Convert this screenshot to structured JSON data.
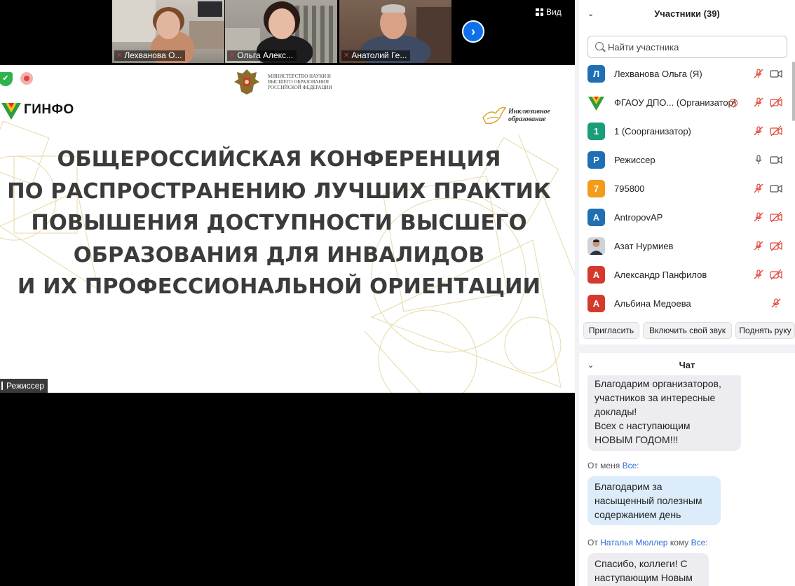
{
  "thumbnails": [
    {
      "name": "Лехванова О..."
    },
    {
      "name": "Ольга Алекс..."
    },
    {
      "name": "Анатолий Ге..."
    }
  ],
  "view_label": "Вид",
  "slide": {
    "ministry": "МИНИСТЕРСТВО НАУКИ И ВЫСШЕГО ОБРАЗОВАНИЯ РОССИЙСКОЙ ФЕДЕРАЦИИ",
    "ginfo": "ГИНФО",
    "inclusive": "Инклюзивное образование",
    "title_lines": [
      "ОБЩЕРОССИЙСКАЯ КОНФЕРЕНЦИЯ",
      "ПО РАСПРОСТРАНЕНИЮ ЛУЧШИХ ПРАКТИК",
      "ПОВЫШЕНИЯ ДОСТУПНОСТИ ВЫСШЕГО",
      "ОБРАЗОВАНИЯ ДЛЯ ИНВАЛИДОВ",
      "И ИХ ПРОФЕССИОНАЛЬНОЙ ОРИЕНТАЦИИ"
    ],
    "speaker_label": "Режиссер"
  },
  "participants": {
    "header": "Участники (39)",
    "search_placeholder": "Найти участника",
    "items": [
      {
        "initial": "Л",
        "name": "Лехванова Ольга (Я)",
        "color": "#1f6fb5"
      },
      {
        "initial": "",
        "name": "ФГАОУ ДПО... (Организатор)",
        "color": "#ffffff"
      },
      {
        "initial": "1",
        "name": "1 (Соорганизатор)",
        "color": "#1a9e7a"
      },
      {
        "initial": "Р",
        "name": "Режиссер",
        "color": "#1f6fb5"
      },
      {
        "initial": "7",
        "name": "795800",
        "color": "#f39b1b"
      },
      {
        "initial": "A",
        "name": "AntropovAP",
        "color": "#1f6fb5"
      },
      {
        "initial": "",
        "name": "Азат Нурмиев",
        "color": "#cccccc"
      },
      {
        "initial": "А",
        "name": "Александр Панфилов",
        "color": "#d43a2c"
      },
      {
        "initial": "А",
        "name": "Альбина Медоева",
        "color": "#d43a2c"
      }
    ],
    "buttons": {
      "invite": "Пригласить",
      "unmute": "Включить свой звук",
      "raise_hand": "Поднять руку"
    }
  },
  "chat": {
    "header": "Чат",
    "messages": [
      {
        "lines": [
          "Благодарим организаторов,",
          "участников за интересные",
          "доклады!",
          "Всех с наступающим",
          "НОВЫМ ГОДОМ!!!"
        ]
      },
      {
        "meta_from": "От меня",
        "meta_to": "Все:",
        "lines": [
          "Благодарим за",
          "насыщенный полезным",
          "содержанием день"
        ]
      },
      {
        "meta_prefix": "От",
        "meta_from": "Наталья Мюллер",
        "meta_mid": "кому",
        "meta_to": "Все:",
        "lines": [
          "Спасибо, коллеги! С",
          "наступающим Новым"
        ]
      }
    ]
  }
}
